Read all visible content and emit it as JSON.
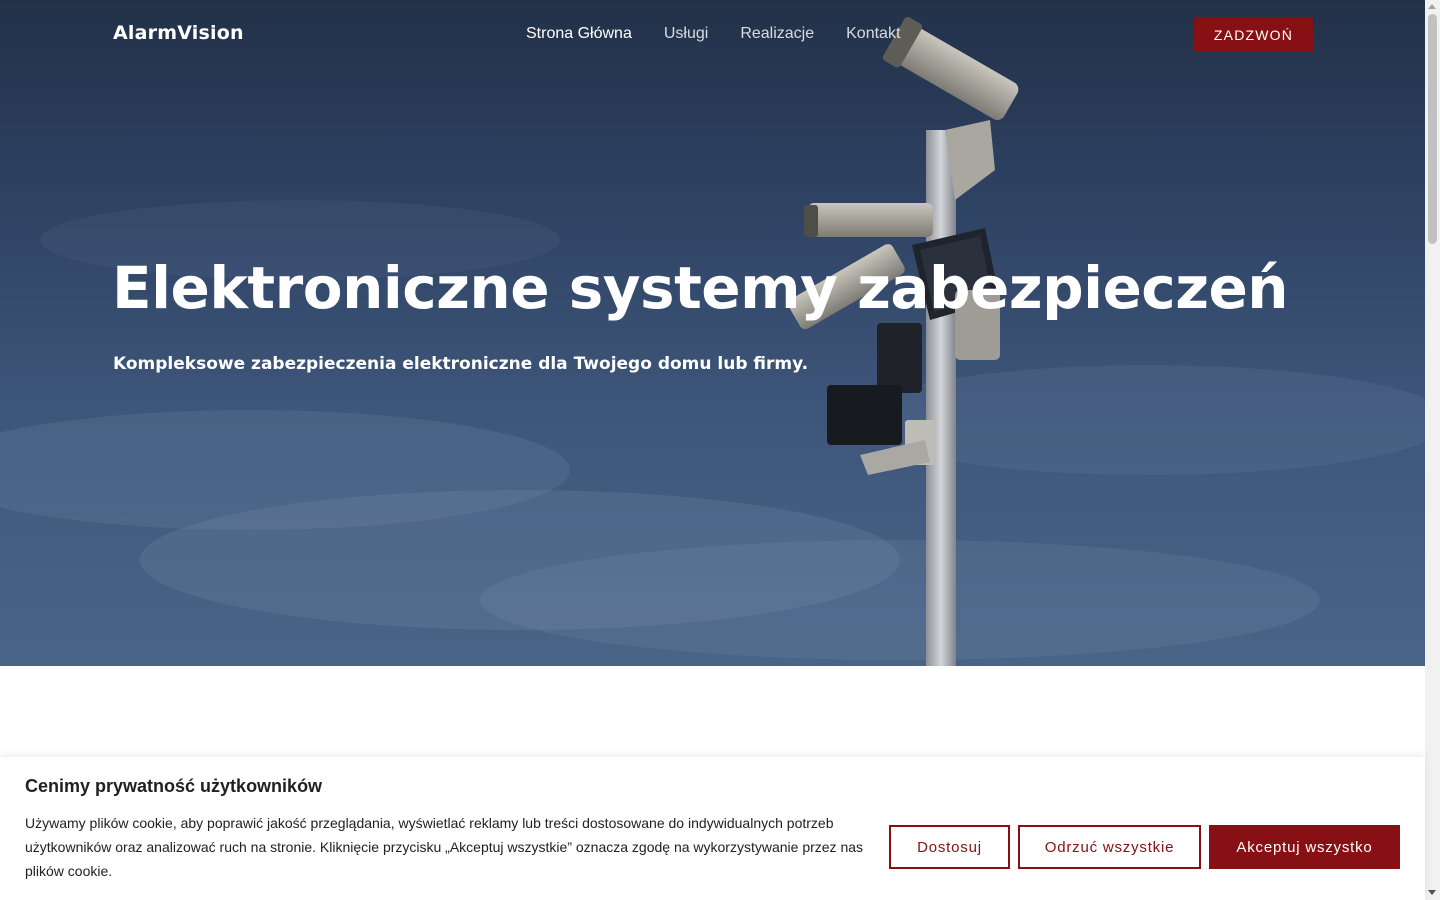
{
  "header": {
    "logo": "AlarmVision",
    "nav": [
      "Strona Główna",
      "Usługi",
      "Realizacje",
      "Kontakt"
    ],
    "active_nav": "Strona Główna",
    "call_label": "ZADZWOŃ"
  },
  "hero": {
    "title": "Elektroniczne systemy zabezpieczeń",
    "subtitle": "Kompleksowe zabezpieczenia elektroniczne dla Twojego domu lub firmy.",
    "image_subject": "security-cameras-on-pole"
  },
  "cookie_banner": {
    "title": "Cenimy prywatność użytkowników",
    "text": "Używamy plików cookie, aby poprawić jakość przeglądania, wyświetlać reklamy lub treści dostosowane do indywidualnych potrzeb użytkowników oraz analizować ruch na stronie. Kliknięcie przycisku „Akceptuj wszystkie” oznacza zgodę na wykorzystywanie przez nas plików cookie.",
    "customize_label": "Dostosuj",
    "reject_label": "Odrzuć wszystkie",
    "accept_label": "Akceptuj wszystko"
  },
  "colors": {
    "accent": "#861014",
    "hero_sky": "#2e4263",
    "text_dark": "#212121"
  }
}
